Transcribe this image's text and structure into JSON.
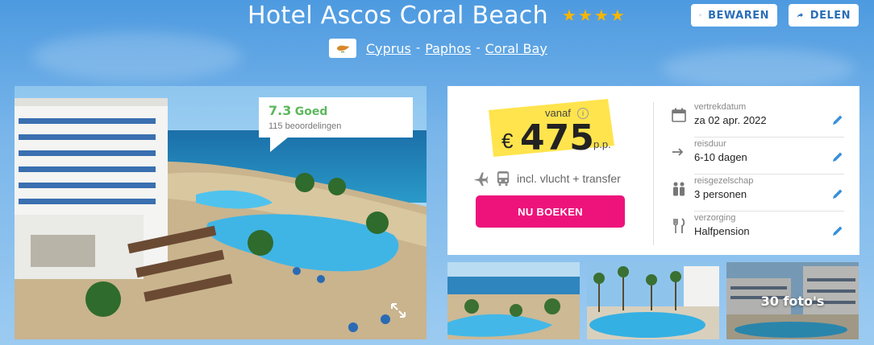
{
  "header": {
    "hotel_name": "Hotel Ascos Coral Beach",
    "stars": 4,
    "save_label": "BEWAREN",
    "share_label": "DELEN",
    "location": [
      "Cyprus",
      "Paphos",
      "Coral Bay"
    ],
    "separator": "-"
  },
  "rating": {
    "score": "7.3",
    "label": "Goed",
    "reviews": "115 beoordelingen"
  },
  "price": {
    "from_label": "vanaf",
    "currency": "€",
    "amount": "475",
    "per_person": "p.p.",
    "includes": "incl. vlucht + transfer",
    "book_label": "NU BOEKEN"
  },
  "details": [
    {
      "label": "vertrekdatum",
      "value": "za 02 apr. 2022",
      "icon": "calendar-icon"
    },
    {
      "label": "reisduur",
      "value": "6-10 dagen",
      "icon": "duration-icon"
    },
    {
      "label": "reisgezelschap",
      "value": "3 personen",
      "icon": "people-icon"
    },
    {
      "label": "verzorging",
      "value": "Halfpension",
      "icon": "cutlery-icon"
    }
  ],
  "gallery": {
    "photo_count_label": "30 foto's"
  },
  "colors": {
    "accent_pink": "#ee137b",
    "link_blue": "#2b6fb8",
    "rating_green": "#5cb85c",
    "highlight_yellow": "#ffe44d"
  }
}
